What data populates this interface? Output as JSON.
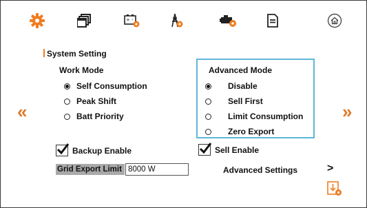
{
  "colors": {
    "accent": "#f07c1e",
    "highlight_border": "#5fb6d8",
    "arrow": "#e07a2a"
  },
  "toolbar": {
    "items": [
      {
        "icon": "gear-icon"
      },
      {
        "icon": "stacked-windows-icon"
      },
      {
        "icon": "battery-gear-icon"
      },
      {
        "icon": "grid-tower-gear-icon"
      },
      {
        "icon": "generator-gear-icon"
      },
      {
        "icon": "document-icon"
      },
      {
        "icon": "home-icon"
      }
    ]
  },
  "section_title": "System Setting",
  "work_mode": {
    "label": "Work Mode",
    "options": [
      "Self Consumption",
      "Peak Shift",
      "Batt Priority"
    ],
    "selected": "Self Consumption"
  },
  "advanced_mode": {
    "label": "Advanced Mode",
    "options": [
      "Disable",
      "Sell First",
      "Limit Consumption",
      "Zero Export"
    ],
    "selected": "Disable"
  },
  "nav": {
    "prev": "«",
    "next": "»"
  },
  "backup_enable": {
    "label": "Backup Enable",
    "checked": true
  },
  "sell_enable": {
    "label": "Sell Enable",
    "checked": true
  },
  "grid_export_limit": {
    "label": "Grid Export Limit",
    "value": "8000",
    "unit": "W"
  },
  "advanced_settings": {
    "label": "Advanced Settings",
    "chevron": ">"
  }
}
